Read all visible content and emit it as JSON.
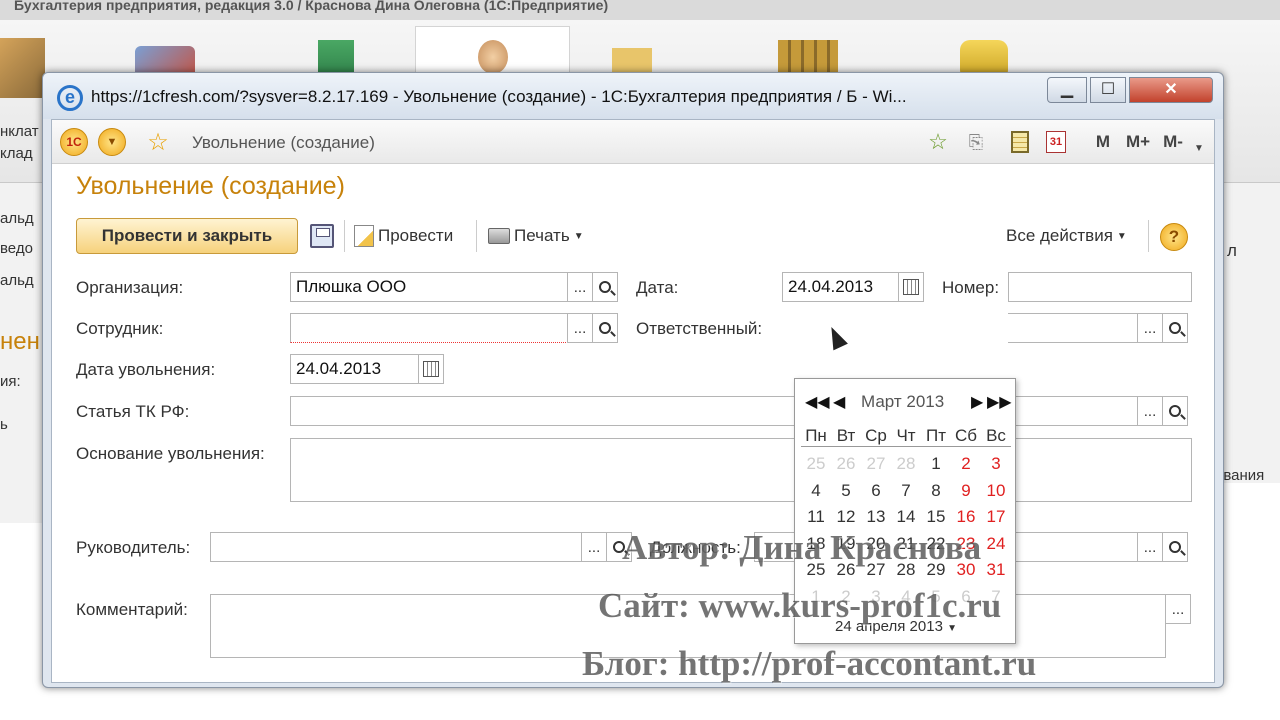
{
  "background": {
    "title": "Бухгалтерия предприятия, редакция 3.0 / Краснова Дина Олеговна (1С:Предприятие)",
    "left_fragments": [
      "нклат",
      "клад",
      "альд",
      "ведо",
      "альд",
      "нен",
      "ия:",
      "ь"
    ],
    "right_fragments": [
      "л",
      "ования"
    ]
  },
  "window": {
    "title": "https://1cfresh.com/?sysver=8.2.17.169 - Увольнение (создание) - 1С:Бухгалтерия предприятия / Б - Wi...",
    "min_label": "▁",
    "max_label": "☐",
    "close_label": "✕"
  },
  "subbar": {
    "title": "Увольнение (создание)",
    "m_label": "M",
    "mplus_label": "M+",
    "mminus_label": "M-"
  },
  "form": {
    "title": "Увольнение (создание)",
    "toolbar": {
      "post_close": "Провести и закрыть",
      "post": "Провести",
      "print": "Печать",
      "all_actions": "Все действия",
      "help": "?"
    },
    "fields": {
      "org_label": "Организация:",
      "org_value": "Плюшка ООО",
      "date_label": "Дата:",
      "date_value": "24.04.2013",
      "number_label": "Номер:",
      "number_value": "",
      "employee_label": "Сотрудник:",
      "employee_value": "",
      "responsible_label": "Ответственный:",
      "dismissal_date_label": "Дата увольнения:",
      "dismissal_date_value": "24.04.2013",
      "article_label": "Статья ТК РФ:",
      "reason_label": "Основание увольнения:",
      "manager_label": "Руководитель:",
      "position_label": "Должность:",
      "comment_label": "Комментарий:",
      "dots": "..."
    }
  },
  "calendar": {
    "month": "Март 2013",
    "days_of_week": [
      "Пн",
      "Вт",
      "Ср",
      "Чт",
      "Пт",
      "Сб",
      "Вс"
    ],
    "weeks": [
      [
        "25",
        "26",
        "27",
        "28",
        "1",
        "2",
        "3"
      ],
      [
        "4",
        "5",
        "6",
        "7",
        "8",
        "9",
        "10"
      ],
      [
        "11",
        "12",
        "13",
        "14",
        "15",
        "16",
        "17"
      ],
      [
        "18",
        "19",
        "20",
        "21",
        "22",
        "23",
        "24"
      ],
      [
        "25",
        "26",
        "27",
        "28",
        "29",
        "30",
        "31"
      ],
      [
        "1",
        "2",
        "3",
        "4",
        "5",
        "6",
        "7"
      ]
    ],
    "footer": "24 апреля 2013",
    "weekend_color": "#e02020",
    "dim_color": "#cccccc"
  },
  "watermark": {
    "author": "Автор: Дина Краснова",
    "site": "Сайт: www.kurs-prof1c.ru",
    "blog": "Блог: http://prof-accontant.ru"
  },
  "colors": {
    "accent": "#c7820b",
    "button_yellow": "#f6d27c"
  }
}
